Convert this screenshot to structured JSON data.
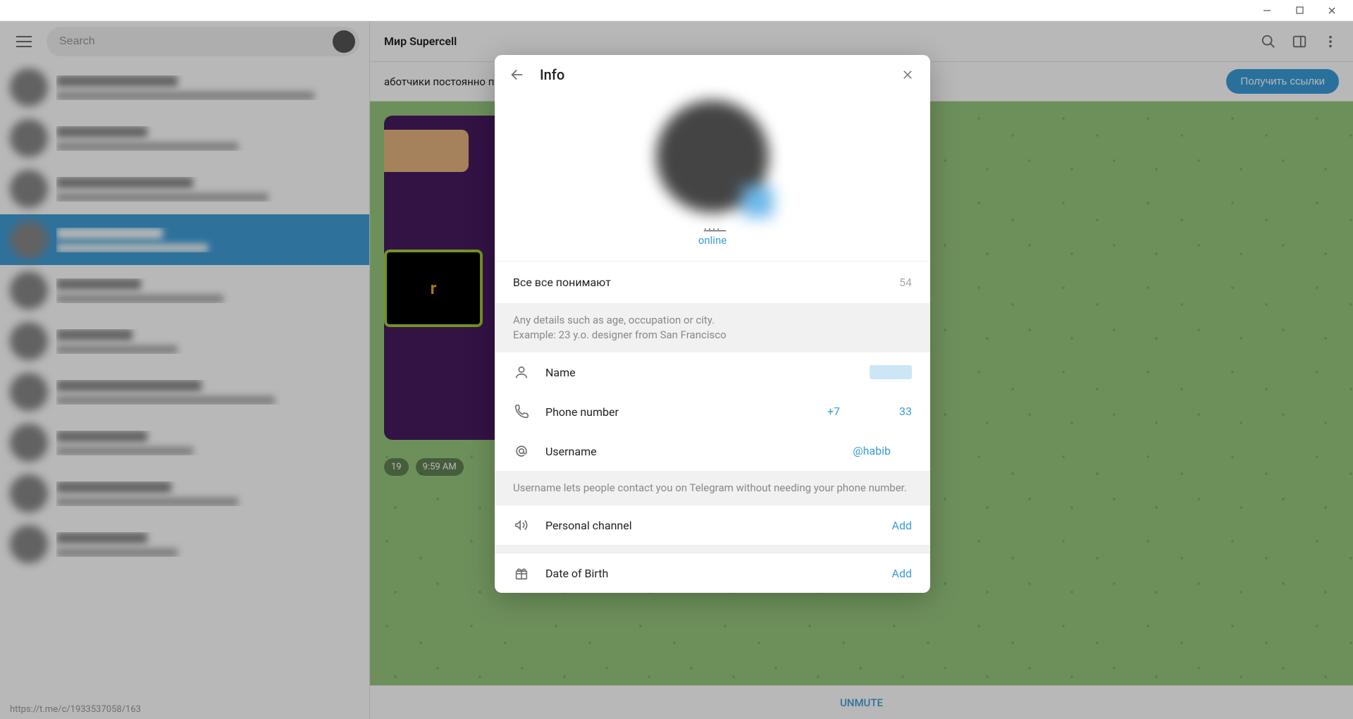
{
  "window": {
    "minimize": "—",
    "maximize": "□",
    "close": "✕"
  },
  "search": {
    "placeholder": "Search"
  },
  "footer": {
    "link": "https://t.me/c/1933537058/163"
  },
  "chat_header": {
    "title": "Мир Supercell"
  },
  "promo": {
    "text": "аботчики постоянно публикуют специаль…",
    "button": "Получить ссылки"
  },
  "message": {
    "inner_label": "r",
    "views": "19",
    "time": "9:59 AM"
  },
  "unmute": "UNMUTE",
  "modal": {
    "title": "Info",
    "profile_name": ".͟.͟.͟.͟",
    "status": "online",
    "bio": {
      "text": "Все все понимают",
      "limit": "54"
    },
    "bio_hint": "Any details such as age, occupation or city.\nExample: 23 y.o. designer from San Francisco",
    "rows": {
      "name": {
        "label": "Name",
        "value": ""
      },
      "phone": {
        "label": "Phone number",
        "prefix": "+7 ",
        "suffix": "33"
      },
      "username": {
        "label": "Username",
        "value": "@habib"
      }
    },
    "username_hint": "Username lets people contact you on Telegram without needing your phone number.",
    "personal_channel": {
      "label": "Personal channel",
      "action": "Add"
    },
    "dob": {
      "label": "Date of Birth",
      "action": "Add"
    }
  }
}
